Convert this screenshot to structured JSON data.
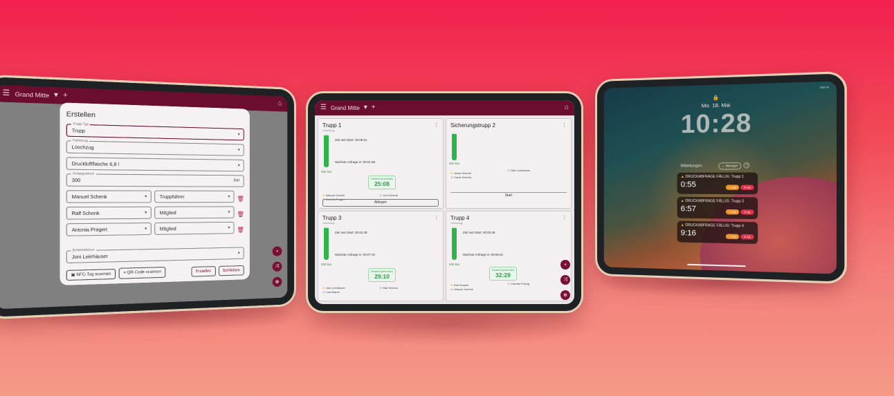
{
  "tablet1": {
    "appbar": {
      "title": "Grand Mitte"
    },
    "dialog": {
      "title": "Erstellen",
      "fields": [
        {
          "label": "Trupp-Typ",
          "value": "Trupp"
        },
        {
          "label": "Fahrzeug",
          "value": "Löschzug"
        },
        {
          "label": "",
          "value": "Druckluftflasche 6,8 l"
        },
        {
          "label": "Anfangsdruck",
          "value": "300",
          "suffix": "bar"
        }
      ],
      "members": [
        {
          "name": "Manuel Schenk",
          "role": "Truppführer"
        },
        {
          "name": "Ralf Schenk",
          "role": "Mitglied"
        },
        {
          "name": "Antonia Pragert",
          "role": "Mitglied"
        }
      ],
      "leader_field": {
        "label": "Einheitsführer",
        "value": "Joni Leinhäuser"
      },
      "buttons": {
        "nfc": "NFC-Tag scannen",
        "qr": "QR-Code scannen",
        "create": "Erstellen",
        "close": "Schließen"
      }
    }
  },
  "tablet2": {
    "appbar": {
      "title": "Grand Mitte"
    },
    "cards": [
      {
        "title": "Trupp 1",
        "sub": "Löschzug",
        "info1": "Zeit seit Start: 00:06:51",
        "info2": "Nächste Anfrage in: 00:01:58",
        "bar": "300 bar",
        "level": 0.95,
        "timer_label": "Restzeit (berechnet)",
        "timer": "25:08",
        "m1": "Manuel Schenk",
        "m2": "Antonia Pragert",
        "m3": "Joni Schenk",
        "button": "Ablegen"
      },
      {
        "title": "Sicherungstrupp 2",
        "sub": "",
        "bar": "300 bar",
        "level": 0.95,
        "m1": "Jonas Schenk",
        "m2": "Frank Schenk",
        "m3": "Ralf Leinhäuser",
        "button": "Start"
      },
      {
        "title": "Trupp 3",
        "sub": "Löschzug",
        "info1": "Zeit seit Start: 00:02:49",
        "info2": "Nächste Anfrage in: 00:07:10",
        "bar": "300 bar",
        "level": 0.95,
        "timer_label": "Restzeit (berechnet)",
        "timer": "29:10",
        "m1": "Joni Leinhäuser",
        "m2": "Lisa Mauer",
        "m3": "Ralf Schenk"
      },
      {
        "title": "Trupp 4",
        "sub": "Löschzug",
        "info1": "Zeit seit Start: 00:00:36",
        "info2": "Nächste Anfrage in: 00:09:22",
        "bar": "300 bar",
        "level": 0.95,
        "timer_label": "Restzeit (berechnet)",
        "timer": "32:29",
        "m1": "Ralf Schenk",
        "m2": "Manuel Schenk",
        "m3": "Claudia Prinzig"
      }
    ]
  },
  "tablet3": {
    "status": "100 %",
    "date": "Mo. 18. Mai",
    "time": "10:28",
    "notif_header": "Mitteilungen",
    "collapse": "Weniger",
    "notifs": [
      {
        "title": "DRUCKABFRAGE FÄLLIG: Trupp 1",
        "value": "0:55",
        "ok": "OK",
        "no": "NL"
      },
      {
        "title": "DRUCKABFRAGE FÄLLIG: Trupp 3",
        "value": "6:57",
        "ok": "OK",
        "no": "NL"
      },
      {
        "title": "DRUCKABFRAGE FÄLLIG: Trupp 4",
        "value": "9:16",
        "ok": "OK",
        "no": "NL"
      }
    ]
  },
  "colors": {
    "brand": "#6b0d2f",
    "green": "#2fb34a",
    "warn": "#f5c518"
  }
}
